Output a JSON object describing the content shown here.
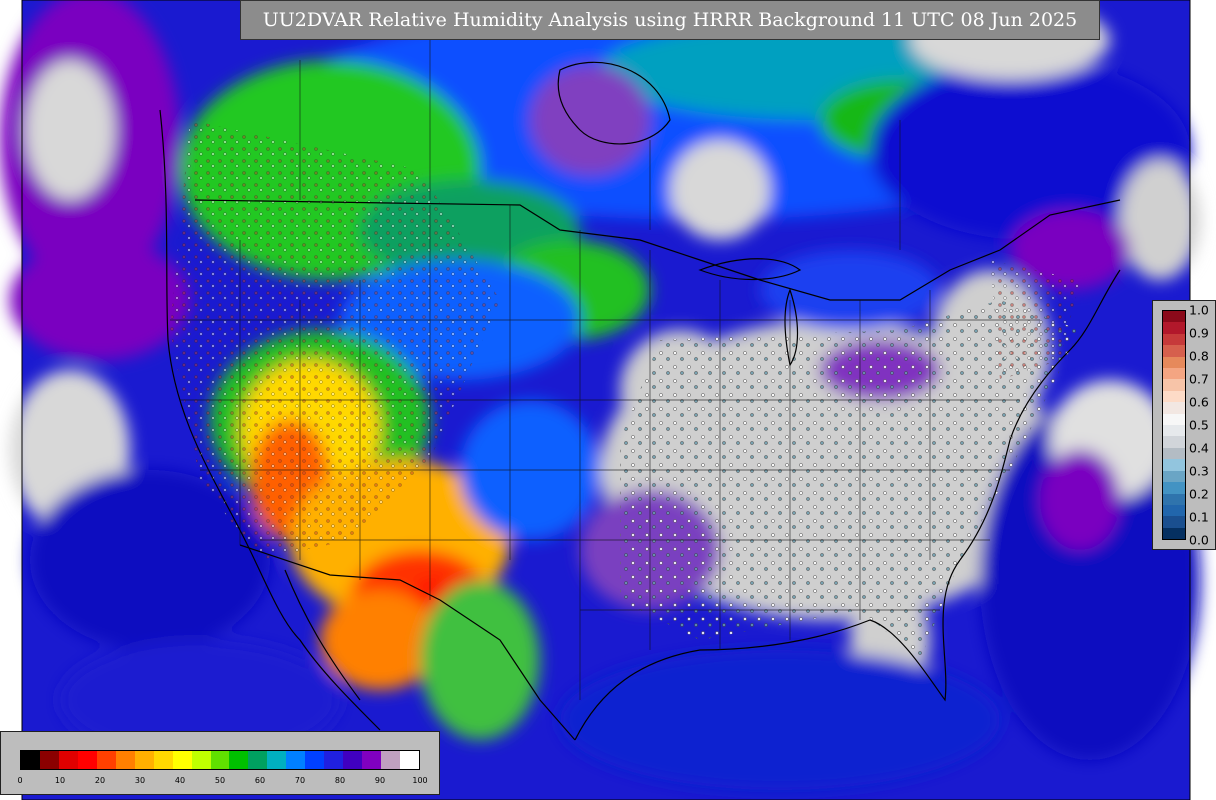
{
  "title": "UU2DVAR Relative Humidity Analysis using HRRR Background 11 UTC 08 Jun 2025",
  "map": {
    "projection": "lambert-conformal",
    "region": "contiguous-united-states",
    "field": "relative-humidity",
    "observations_shown": true
  },
  "rh_colorbar": {
    "ticks": [
      "0",
      "10",
      "20",
      "30",
      "40",
      "50",
      "60",
      "70",
      "80",
      "90",
      "100"
    ],
    "colors": [
      "#000000",
      "#8b0000",
      "#e00000",
      "#ff0000",
      "#ff4000",
      "#ff8000",
      "#ffb000",
      "#ffd800",
      "#ffff00",
      "#c0ff00",
      "#60e000",
      "#00c000",
      "#00a060",
      "#00b0c0",
      "#0080ff",
      "#0040ff",
      "#2020e0",
      "#4000c0",
      "#8000c0",
      "#c0a0c0",
      "#ffffff"
    ]
  },
  "bias_colorbar": {
    "ticks": [
      "1.0",
      "0.9",
      "0.8",
      "0.7",
      "0.6",
      "0.5",
      "0.4",
      "0.3",
      "0.2",
      "0.1",
      "0.0"
    ],
    "colors": [
      "#8b0a1a",
      "#b2182b",
      "#c63a3a",
      "#d6604d",
      "#e6895b",
      "#f4a582",
      "#f7c4a8",
      "#fddbc7",
      "#f2e7e2",
      "#f7f7f7",
      "#e6e9ec",
      "#d1d5da",
      "#b3bcc4",
      "#92c5de",
      "#6aa5c5",
      "#4393c3",
      "#2f74ad",
      "#2166ac",
      "#1a4f8f",
      "#053061"
    ]
  },
  "colors": {
    "ocean_deep": "#1a1ad0",
    "ocean_mid": "#0a50ff",
    "dry_core": "#ff2000",
    "gray_land": "#cfcfcf",
    "green": "#1cc81c",
    "purple": "#7a00c0"
  }
}
